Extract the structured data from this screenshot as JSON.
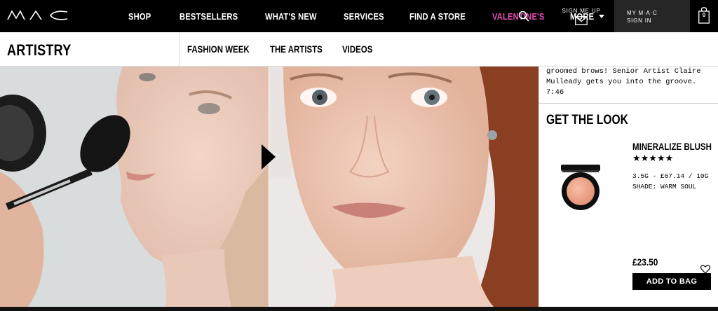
{
  "brand": {
    "logo_text": "MAC"
  },
  "nav": {
    "items": [
      {
        "label": "SHOP"
      },
      {
        "label": "BESTSELLERS"
      },
      {
        "label": "WHAT'S NEW"
      },
      {
        "label": "SERVICES"
      },
      {
        "label": "FIND A STORE"
      },
      {
        "label": "VALENTINE'S",
        "color": "#e44fb2"
      },
      {
        "label": "MORE"
      }
    ],
    "signup_label": "SIGN ME UP",
    "mymac_line1": "MY M·A·C",
    "mymac_line2": "SIGN IN",
    "bag_count": "0",
    "icons": [
      "search-icon",
      "mail-icon",
      "bag-icon",
      "chevron-down-icon"
    ]
  },
  "subnav": {
    "title": "ARTISTRY",
    "links": [
      {
        "label": "FASHION WEEK"
      },
      {
        "label": "THE ARTISTS"
      },
      {
        "label": "VIDEOS"
      }
    ]
  },
  "hero": {
    "icon": "play-icon"
  },
  "sidebar": {
    "video_description": "groomed brows! Senior Artist Claire Mulleady gets you into the groove. 7:46",
    "get_the_look_title": "GET THE LOOK",
    "product": {
      "name": "MINERALIZE BLUSH",
      "rating_display": "★★★★★",
      "rating": 5,
      "size_price": "3.5G - £67.14 / 10G",
      "shade": "SHADE: WARM SOUL",
      "price": "£23.50",
      "add_to_bag_label": "ADD TO BAG",
      "blush_color": "#f0a58a"
    }
  }
}
